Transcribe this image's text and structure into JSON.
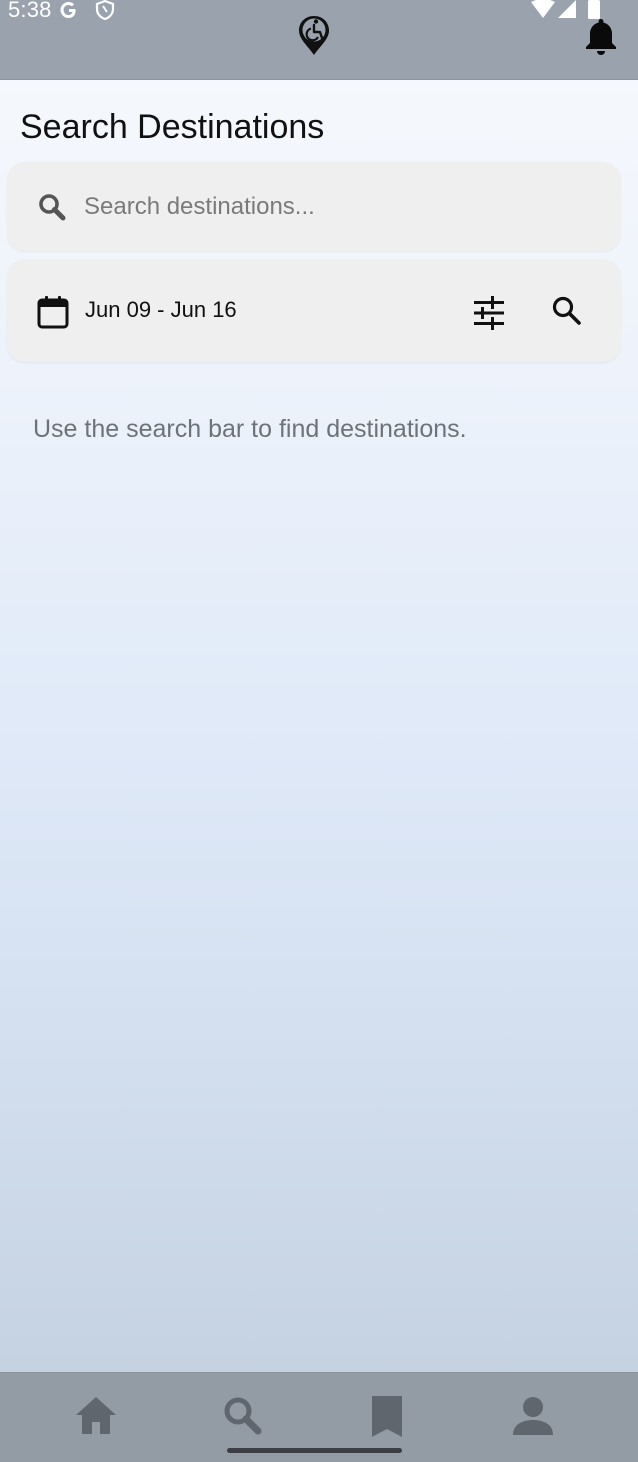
{
  "status_bar": {
    "time": "5:38",
    "icons": [
      "google-icon",
      "shield-icon",
      "wifi-icon",
      "signal-icon",
      "battery-icon"
    ]
  },
  "header": {
    "logo_icon": "accessibility-location-icon",
    "notifications_icon": "bell-icon"
  },
  "page": {
    "title": "Search Destinations"
  },
  "search": {
    "placeholder": "Search destinations...",
    "value": "",
    "icon": "search-icon"
  },
  "filters": {
    "date_range": "Jun 09 - Jun 16",
    "calendar_icon": "calendar-icon",
    "tune_icon": "tune-icon",
    "search_icon": "search-icon"
  },
  "empty_state": {
    "message": "Use the search bar to find destinations."
  },
  "bottom_nav": {
    "items": [
      {
        "name": "home",
        "icon": "home-icon"
      },
      {
        "name": "search",
        "icon": "search-icon",
        "active": true
      },
      {
        "name": "saved",
        "icon": "bookmark-icon"
      },
      {
        "name": "profile",
        "icon": "person-icon"
      }
    ]
  },
  "colors": {
    "status_bar": "#9aa3ad",
    "bottom_nav": "#939ba5",
    "card": "#efefef",
    "muted_text": "#6e7379",
    "nav_icon": "#5f666e"
  }
}
